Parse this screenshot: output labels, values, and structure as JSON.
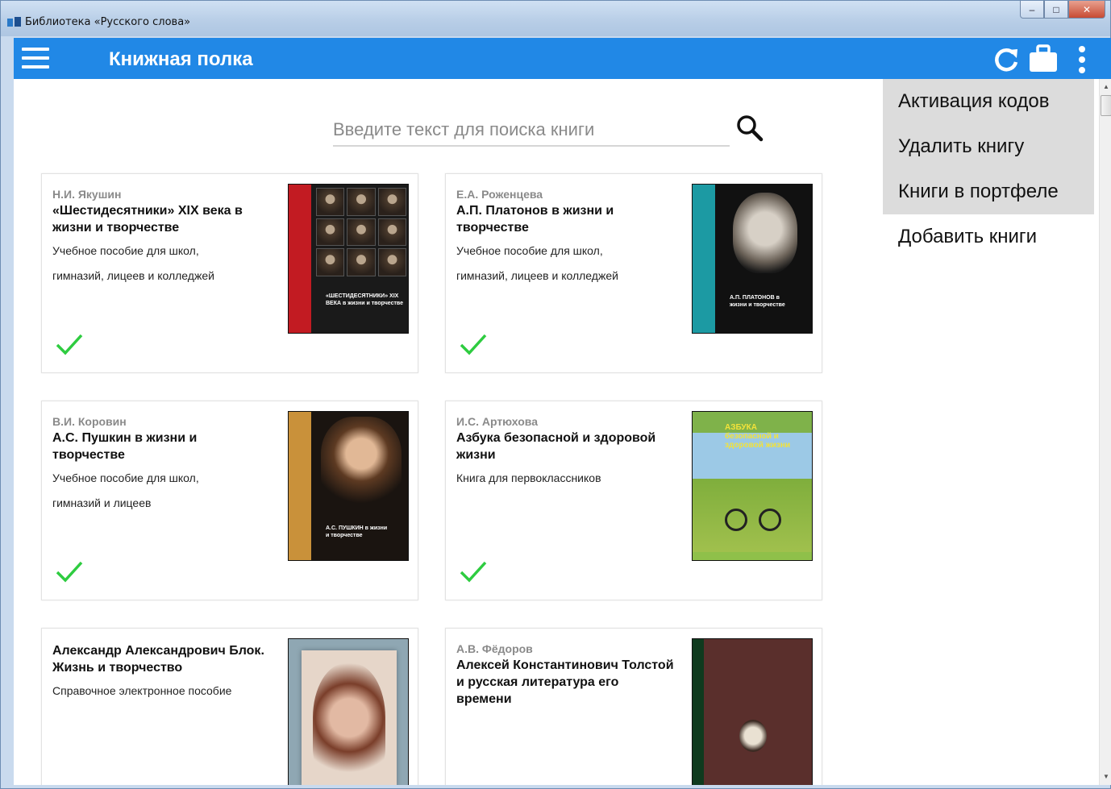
{
  "window": {
    "title": "Библиотека «Русского слова»",
    "controls": {
      "minimize": "–",
      "maximize": "□",
      "close": "✕"
    }
  },
  "appbar": {
    "title": "Книжная полка",
    "icons": [
      "menu-icon",
      "refresh-icon",
      "briefcase-icon",
      "more-vert-icon"
    ],
    "color": "#2188e6"
  },
  "search": {
    "placeholder": "Введите текст для поиска книги",
    "value": ""
  },
  "books": [
    {
      "author": "Н.И. Якушин",
      "title": "«Шестидесятники» XIX века в жизни и творчестве",
      "description": [
        "Учебное пособие для школ,",
        "гимназий, лицеев и колледжей"
      ],
      "downloaded": true,
      "cover": {
        "accent": "#c21b22",
        "text": "«ШЕСТИДЕСЯТНИКИ» XIX ВЕКА в жизни и творчестве"
      }
    },
    {
      "author": "Е.А. Роженцева",
      "title": "А.П. Платонов в жизни и творчестве",
      "description": [
        "Учебное пособие для школ,",
        "гимназий, лицеев и колледжей"
      ],
      "downloaded": true,
      "cover": {
        "accent": "#1c9aa3",
        "text": "А.П. ПЛАТОНОВ в жизни и творчестве"
      }
    },
    {
      "author": "В.И. Коровин",
      "title": "А.С. Пушкин в жизни и творчестве",
      "description": [
        "Учебное пособие для школ,",
        "гимназий и лицеев"
      ],
      "downloaded": true,
      "cover": {
        "accent": "#c9913a",
        "text": "А.С. ПУШКИН в жизни и творчестве"
      }
    },
    {
      "author": "И.С. Артюхова",
      "title": "Азбука безопасной и здоровой жизни",
      "description": [
        "Книга для первоклассников"
      ],
      "downloaded": true,
      "cover": {
        "accent": "#8fc04a",
        "text": "АЗБУКА безопасной и здоровой жизни"
      }
    },
    {
      "author": "",
      "title": "Александр Александрович Блок. Жизнь и творчество",
      "description": [
        "Справочное электронное пособие"
      ],
      "downloaded": false,
      "cover": {
        "accent": "#8fa7b3",
        "text": ""
      }
    },
    {
      "author": "А.В. Фёдоров",
      "title": "Алексей Константинович Толстой и русская литература его времени",
      "description": [],
      "downloaded": false,
      "cover": {
        "accent": "#5a2f2c",
        "text": ""
      }
    }
  ],
  "menu": {
    "items": [
      {
        "label": "Активация кодов",
        "highlighted": true
      },
      {
        "label": "Удалить книгу",
        "highlighted": true
      },
      {
        "label": "Книги в портфеле",
        "highlighted": true
      },
      {
        "label": "Добавить книги",
        "highlighted": false
      }
    ]
  },
  "colors": {
    "check": "#2ecc40",
    "menuBg": "#dcdcdc"
  }
}
